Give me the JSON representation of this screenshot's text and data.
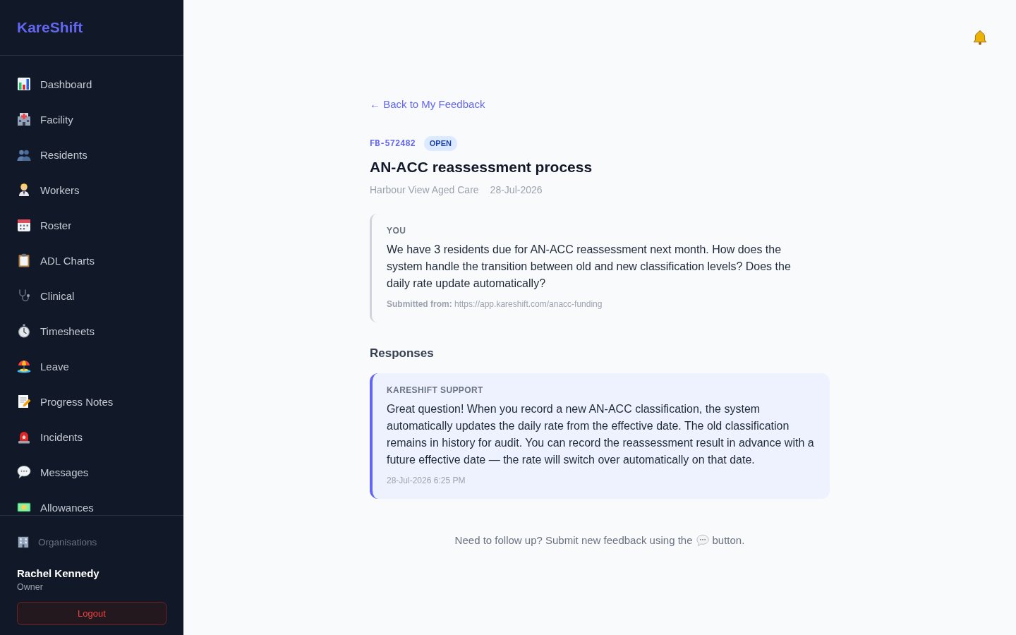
{
  "sidebar": {
    "logo": "KareShift",
    "nav_items": [
      {
        "label": "Dashboard",
        "selected": false
      },
      {
        "label": "Facility",
        "selected": false
      },
      {
        "label": "Residents",
        "selected": false
      },
      {
        "label": "Workers",
        "selected": false
      },
      {
        "label": "Roster",
        "selected": false
      },
      {
        "label": "ADL Charts",
        "selected": false
      },
      {
        "label": "Clinical",
        "selected": false
      },
      {
        "label": "Timesheets",
        "selected": false
      },
      {
        "label": "Leave",
        "selected": false
      },
      {
        "label": "Progress Notes",
        "selected": false
      },
      {
        "label": "Incidents",
        "selected": false
      },
      {
        "label": "Messages",
        "selected": false
      },
      {
        "label": "Allowances",
        "selected": false
      }
    ],
    "organisations_link": "Organisations",
    "user": {
      "name": "Rachel Kennedy",
      "role": "Owner"
    },
    "logout_button": "Logout"
  },
  "feedback": {
    "back_link": "← Back to My Feedback",
    "id": "FB-572482",
    "status": "OPEN",
    "title": "AN-ACC reassessment process",
    "facility": "Harbour View Aged Care",
    "date": "28-Jul-2026",
    "message": {
      "author": "YOU",
      "body": "We have 3 residents due for AN-ACC reassessment next month. How does the system handle the transition between old and new classification levels? Does the daily rate update automatically?",
      "source": "**Submitted from:** https://app.kareshift.com/anacc-funding"
    }
  },
  "responses": {
    "heading": "Responses",
    "items": [
      {
        "author": "KARESHIFT SUPPORT",
        "body": "Great question! When you record a new AN-ACC classification, the system automatically updates the daily rate from the effective date. The old classification remains in history for audit. You can record the reassessment result in advance with a future effective date — the rate will switch over automatically on that date.",
        "timestamp": "28-Jul-2026 6:25 PM"
      }
    ]
  },
  "footer_note": {
    "text_before_icon": "Need to follow up? Submit new feedback using the",
    "text_after_icon": "button."
  }
}
